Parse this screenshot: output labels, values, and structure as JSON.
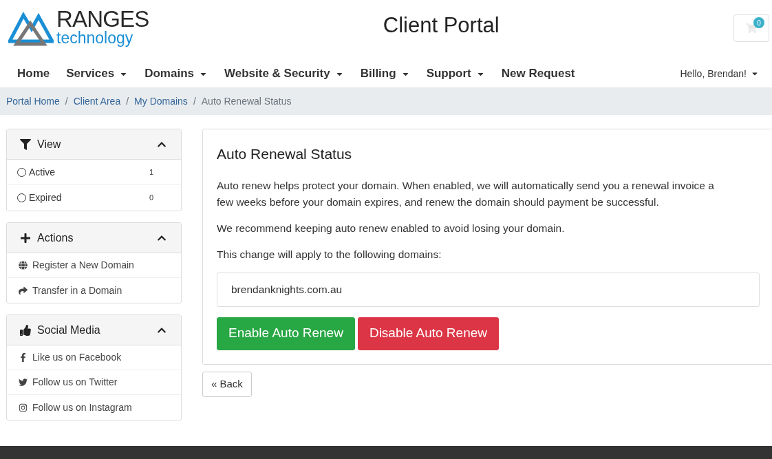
{
  "logo": {
    "word": "RANGES",
    "tagline": "technology"
  },
  "header": {
    "title": "Client Portal",
    "cart_count": "0"
  },
  "nav": {
    "items": [
      {
        "label": "Home",
        "dropdown": false
      },
      {
        "label": "Services",
        "dropdown": true
      },
      {
        "label": "Domains",
        "dropdown": true
      },
      {
        "label": "Website & Security",
        "dropdown": true
      },
      {
        "label": "Billing",
        "dropdown": true
      },
      {
        "label": "Support",
        "dropdown": true
      },
      {
        "label": "New Request",
        "dropdown": false
      }
    ],
    "user": "Hello, Brendan!"
  },
  "breadcrumb": {
    "separator": "/",
    "items": [
      {
        "label": "Portal Home",
        "link": true
      },
      {
        "label": "Client Area",
        "link": true
      },
      {
        "label": "My Domains",
        "link": true
      },
      {
        "label": "Auto Renewal Status",
        "link": false
      }
    ]
  },
  "sidebar": [
    {
      "title": "View",
      "expanded": true,
      "items": [
        {
          "kind": "radio",
          "label": "Active",
          "count": "1",
          "selected": false
        },
        {
          "kind": "radio",
          "label": "Expired",
          "count": "0",
          "selected": false
        }
      ]
    },
    {
      "title": "Actions",
      "expanded": true,
      "items": [
        {
          "kind": "link",
          "label": "Register a New Domain"
        },
        {
          "kind": "link",
          "label": "Transfer in a Domain"
        }
      ]
    },
    {
      "title": "Social Media",
      "expanded": true,
      "items": [
        {
          "kind": "link",
          "label": "Like us on Facebook"
        },
        {
          "kind": "link",
          "label": "Follow us on Twitter"
        },
        {
          "kind": "link",
          "label": "Follow us on Instagram"
        }
      ]
    }
  ],
  "main": {
    "title": "Auto Renewal Status",
    "paragraphs": [
      "Auto renew helps protect your domain. When enabled, we will automatically send you a renewal invoice a few weeks before your domain expires, and renew the domain should payment be successful.",
      "We recommend keeping auto renew enabled to avoid losing your domain.",
      "This change will apply to the following domains:"
    ],
    "domains": [
      "brendanknights.com.au"
    ],
    "buttons": [
      {
        "label": "Enable Auto Renew",
        "kind": "success"
      },
      {
        "label": "Disable Auto Renew",
        "kind": "danger"
      }
    ],
    "back": "« Back"
  }
}
